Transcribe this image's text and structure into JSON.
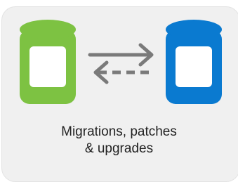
{
  "card": {
    "caption_line1": "Migrations, patches",
    "caption_line2": "& upgrades"
  },
  "icons": {
    "source_db": "database-icon",
    "target_db": "database-icon",
    "forward_arrow": "arrow-right-icon",
    "backward_arrow": "dashed-arrow-left-icon"
  },
  "colors": {
    "source_db": "#7dc242",
    "target_db": "#0a7ad0",
    "arrows": "#7a7a7a",
    "card_bg": "#f0f0f0",
    "text": "#222222"
  }
}
